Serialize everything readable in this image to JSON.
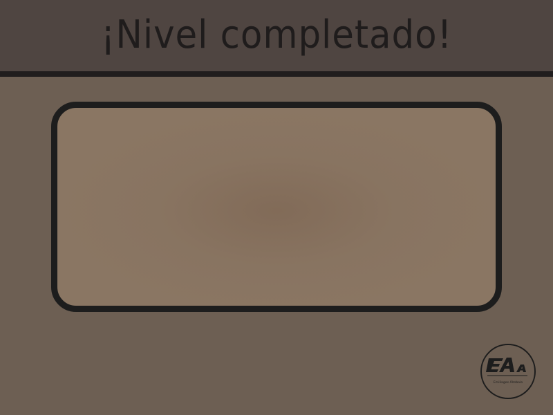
{
  "header": {
    "title": "¡Nivel completado!"
  },
  "panel": {
    "content": ""
  },
  "logo": {
    "caption": "Emiliagos Álmbolo"
  },
  "colors": {
    "background": "#6d5f53",
    "header": "#4f4541",
    "divider": "#201d1d",
    "panel": "#8a7663",
    "outline": "#1d1d1d",
    "text": "#1f1c1c"
  }
}
